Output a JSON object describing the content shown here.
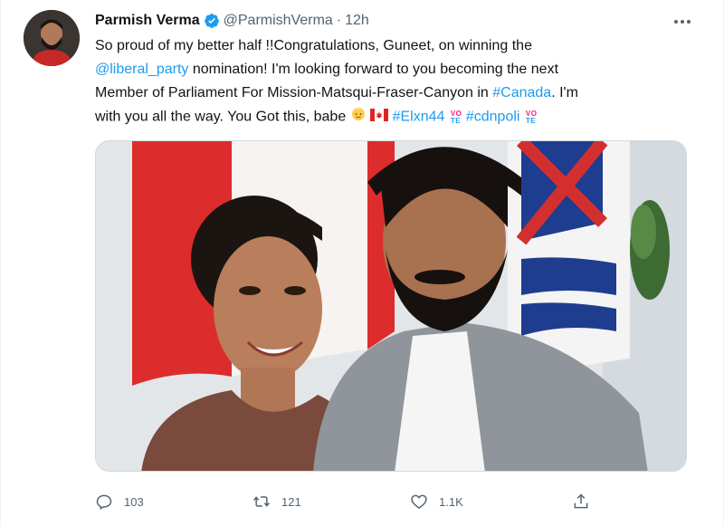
{
  "author": {
    "display_name": "Parmish Verma",
    "handle": "@ParmishVerma",
    "separator": "·",
    "time": "12h"
  },
  "tweet": {
    "line1": "So proud of my better half !!Congratulations, Guneet, on winning the",
    "mention": "@liberal_party",
    "line2_rest": " nomination! I'm looking forward to you becoming the next",
    "line3_start": "Member of Parliament For Mission-Matsqui-Fraser-Canyon in ",
    "hashtag_canada": "#Canada",
    "line3_end": ". I'm",
    "line4_start": "with you all the way. You Got this, babe ",
    "hashtag_elxn": "#Elxn44",
    "hashtag_cdnpoli": "#cdnpoli",
    "vote_top": "VO",
    "vote_bottom": "TE"
  },
  "actions": {
    "reply_count": "103",
    "retweet_count": "121",
    "like_count": "1.1K"
  },
  "icons": {
    "verified": "verified-badge-icon",
    "more": "more-options-icon",
    "reply": "reply-icon",
    "retweet": "retweet-icon",
    "like": "heart-icon",
    "share": "share-icon"
  },
  "colors": {
    "link": "#1d9bf0",
    "secondary_text": "#536471",
    "vote_pink": "#f91880",
    "vote_blue": "#1d9bf0"
  }
}
